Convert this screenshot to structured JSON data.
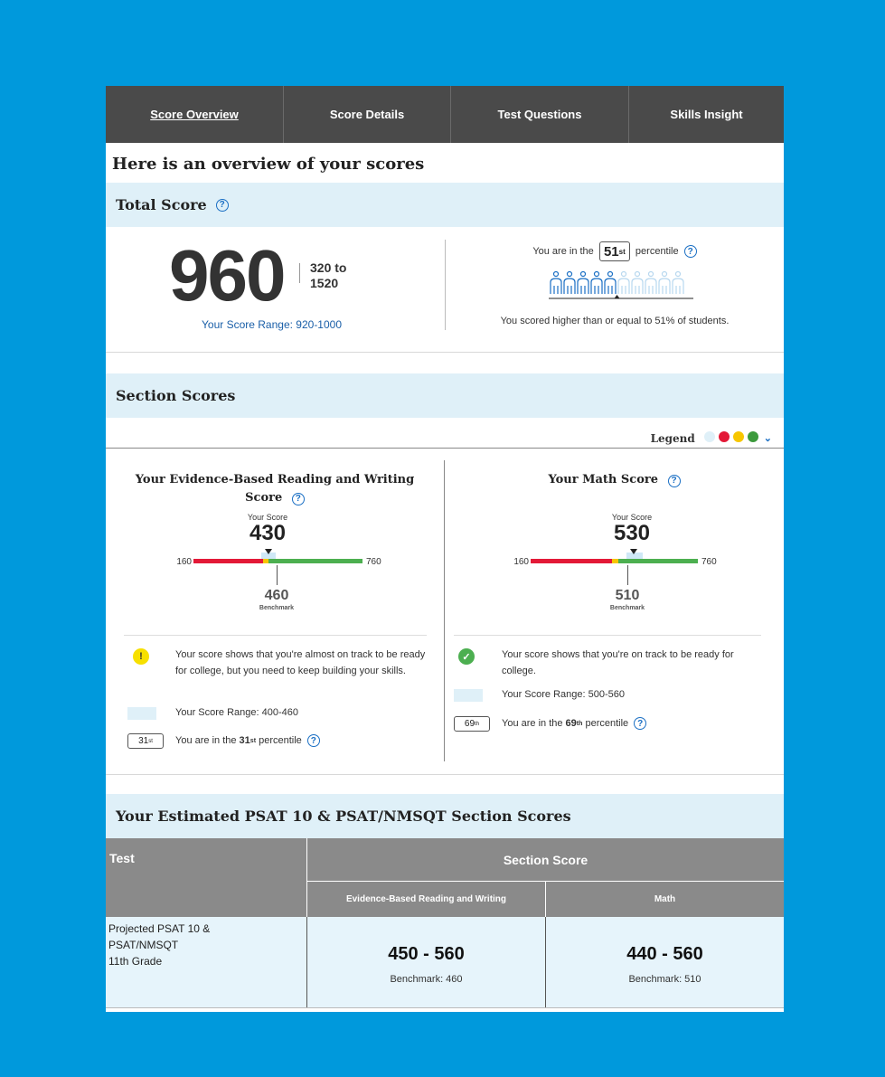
{
  "nav": {
    "tabs": [
      {
        "label": "Score Overview"
      },
      {
        "label": "Score Details"
      },
      {
        "label": "Test Questions"
      },
      {
        "label": "Skills Insight"
      }
    ]
  },
  "page_heading": "Here is an overview of your scores",
  "total": {
    "title": "Total Score",
    "score": "960",
    "range_top": "320 to",
    "range_bottom": "1520",
    "score_range": "Your Score Range: 920-1000",
    "percentile_prefix": "You are in the",
    "percentile": "51",
    "percentile_sup": "st",
    "percentile_suffix": "percentile",
    "percentile_note": "You scored higher than or equal to 51% of students.",
    "people_total": 10,
    "people_filled": 5
  },
  "section": {
    "title": "Section Scores",
    "legend_label": "Legend",
    "legend_colors": [
      "#dff0f8",
      "#e31937",
      "#f7c600",
      "#3c9a3c"
    ],
    "ebrw": {
      "title_line1": "Your Evidence-Based Reading and Writing",
      "title_line2": "Score",
      "your_score_label": "Your Score",
      "score": "430",
      "min": "160",
      "max": "760",
      "benchmark": "460",
      "benchmark_label": "Benchmark",
      "message": "Your score shows that you're almost on track to be ready for college, but you need to keep building your skills.",
      "status_icon": "warning-icon",
      "status_color": "#f7e000",
      "range": "Your Score Range: 400-460",
      "percentile_badge": "31",
      "percentile_badge_sup": "st",
      "percentile_prefix": "You are in the",
      "percentile_bold": "31",
      "percentile_sup": "st",
      "percentile_suffix": "percentile"
    },
    "math": {
      "title": "Your Math Score",
      "your_score_label": "Your Score",
      "score": "530",
      "min": "160",
      "max": "760",
      "benchmark": "510",
      "benchmark_label": "Benchmark",
      "message": "Your score shows that you're on track to be ready for college.",
      "status_icon": "check-icon",
      "status_color": "#4caf50",
      "range": "Your Score Range: 500-560",
      "percentile_badge": "69",
      "percentile_badge_sup": "th",
      "percentile_prefix": "You are in the",
      "percentile_bold": "69",
      "percentile_sup": "th",
      "percentile_suffix": "percentile"
    }
  },
  "psat": {
    "title": "Your Estimated PSAT 10 & PSAT/NMSQT Section Scores",
    "col_test": "Test",
    "col_section": "Section Score",
    "col_ebrw": "Evidence-Based Reading and Writing",
    "col_math": "Math",
    "row": {
      "test_line1": "Projected  PSAT 10 &",
      "test_line2": "PSAT/NMSQT",
      "test_line3": "11th Grade",
      "ebrw_score": "450 - 560",
      "ebrw_benchmark": "Benchmark: 460",
      "math_score": "440 - 560",
      "math_benchmark": "Benchmark: 510"
    }
  }
}
